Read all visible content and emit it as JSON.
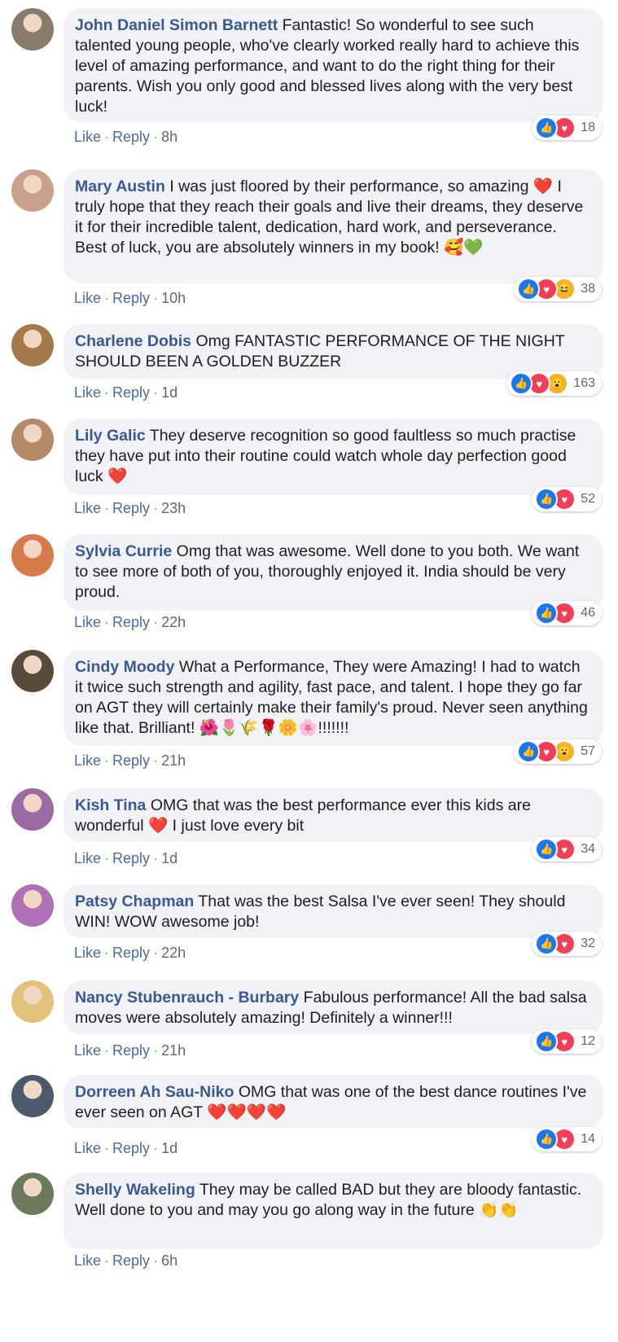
{
  "comments": [
    {
      "name": "John Daniel Simon Barnett",
      "text": "Fantastic! So wonderful to see such talented young people, who've clearly worked really hard to achieve this level of amazing performance, and want to do the right thing for their parents. Wish you only good and blessed lives along with the very best luck!",
      "like": "Like",
      "reply": "Reply",
      "time": "8h",
      "count": "18",
      "reactions": [
        "like",
        "love"
      ],
      "avatar_color": "#8a7a6a"
    },
    {
      "name": "Mary Austin",
      "text": "I was just floored by their performance, so amazing ❤️ I truly hope that they reach their goals and live their dreams, they deserve it for their incredible talent, dedication, hard work, and perseverance. Best of luck, you are absolutely winners in my book! 🥰💚",
      "like": "Like",
      "reply": "Reply",
      "time": "10h",
      "count": "38",
      "reactions": [
        "like",
        "love",
        "haha"
      ],
      "avatar_color": "#c9a08c"
    },
    {
      "name": "Charlene Dobis",
      "text": "Omg FANTASTIC PERFORMANCE OF THE NIGHT SHOULD BEEN A GOLDEN BUZZER",
      "like": "Like",
      "reply": "Reply",
      "time": "1d",
      "count": "163",
      "reactions": [
        "like",
        "love",
        "wow"
      ],
      "avatar_color": "#a57a4a"
    },
    {
      "name": "Lily Galic",
      "text": "They deserve recognition so good faultless so much practise they have put into their routine could watch whole day perfection good luck ❤️",
      "like": "Like",
      "reply": "Reply",
      "time": "23h",
      "count": "52",
      "reactions": [
        "like",
        "love"
      ],
      "avatar_color": "#b58a6a"
    },
    {
      "name": "Sylvia Currie",
      "text": "Omg that was awesome. Well done to you both. We want to see more of both of you, thoroughly enjoyed it. India should be very proud.",
      "like": "Like",
      "reply": "Reply",
      "time": "22h",
      "count": "46",
      "reactions": [
        "like",
        "love"
      ],
      "avatar_color": "#d77a4a"
    },
    {
      "name": "Cindy Moody",
      "text": "What a Performance, They were Amazing! I had to watch it twice such strength and agility, fast pace, and talent. I hope they go far on AGT they will certainly make their family's proud. Never seen anything like that. Brilliant! 🌺🌷🌾🌹🌼🌸!!!!!!!",
      "like": "Like",
      "reply": "Reply",
      "time": "21h",
      "count": "57",
      "reactions": [
        "like",
        "love",
        "wow"
      ],
      "avatar_color": "#5a4a3a"
    },
    {
      "name": "Kish Tina",
      "text": "OMG that was the best performance ever this kids are wonderful ❤️ I just love every bit",
      "like": "Like",
      "reply": "Reply",
      "time": "1d",
      "count": "34",
      "reactions": [
        "like",
        "love"
      ],
      "avatar_color": "#9a6aa0"
    },
    {
      "name": "Patsy Chapman",
      "text": "That was the best Salsa I've ever seen! They should WIN! WOW awesome job!",
      "like": "Like",
      "reply": "Reply",
      "time": "22h",
      "count": "32",
      "reactions": [
        "like",
        "love"
      ],
      "avatar_color": "#b070b8"
    },
    {
      "name": "Nancy Stubenrauch - Burbary",
      "text": "Fabulous performance! All the bad salsa moves were absolutely amazing! Definitely a winner!!!",
      "like": "Like",
      "reply": "Reply",
      "time": "21h",
      "count": "12",
      "reactions": [
        "like",
        "love"
      ],
      "avatar_color": "#e2c27a"
    },
    {
      "name": "Dorreen Ah Sau-Niko",
      "text": "OMG that was one of the best dance routines I've ever seen on AGT ❤️❤️❤️❤️",
      "like": "Like",
      "reply": "Reply",
      "time": "1d",
      "count": "14",
      "reactions": [
        "like",
        "love"
      ],
      "avatar_color": "#4a5a6a"
    },
    {
      "name": "Shelly Wakeling",
      "text": "They may be called BAD but they are bloody fantastic. Well done to you and may you go along way in the future 👏👏",
      "like": "Like",
      "reply": "Reply",
      "time": "6h",
      "count": "",
      "reactions": [],
      "avatar_color": "#6a7a5a"
    }
  ]
}
